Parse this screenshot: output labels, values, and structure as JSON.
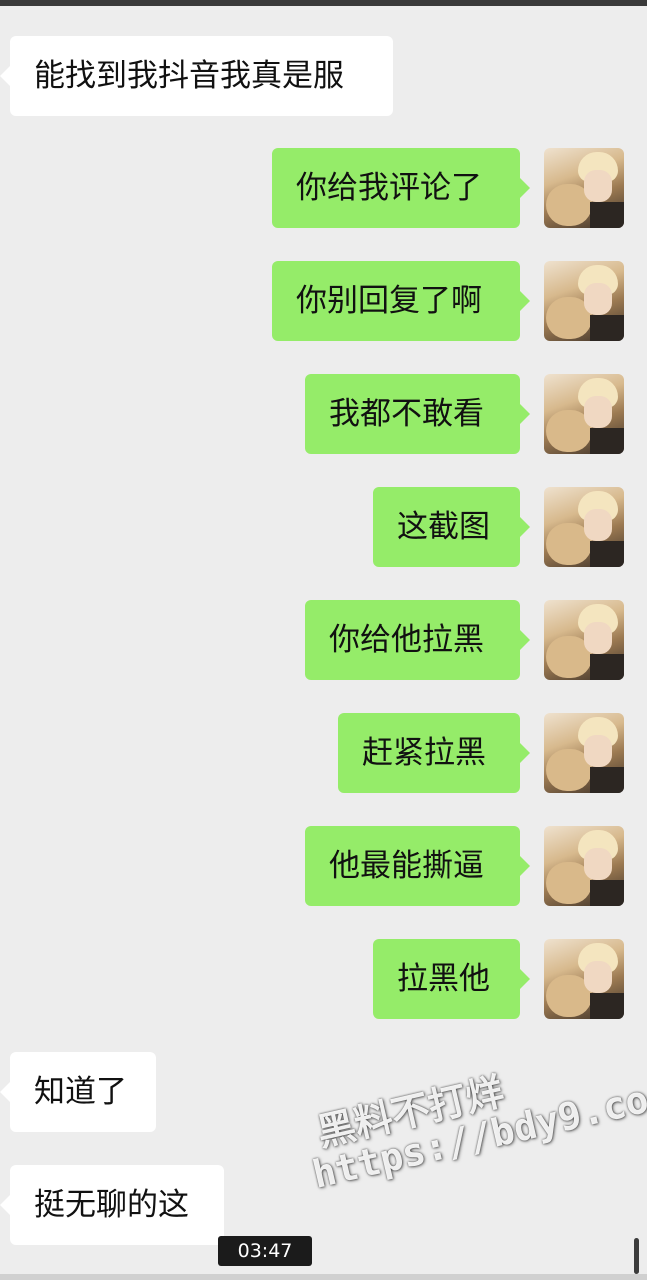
{
  "messages": [
    {
      "side": "received",
      "text": "能找到我抖音我真是服"
    },
    {
      "side": "sent",
      "text": "你给我评论了"
    },
    {
      "side": "sent",
      "text": "你别回复了啊"
    },
    {
      "side": "sent",
      "text": "我都不敢看"
    },
    {
      "side": "sent",
      "text": "这截图"
    },
    {
      "side": "sent",
      "text": "你给他拉黑"
    },
    {
      "side": "sent",
      "text": "赶紧拉黑"
    },
    {
      "side": "sent",
      "text": "他最能撕逼"
    },
    {
      "side": "sent",
      "text": "拉黑他"
    },
    {
      "side": "received",
      "text": "知道了"
    },
    {
      "side": "received",
      "text": "挺无聊的这"
    }
  ],
  "watermark": {
    "line1": "黑料不打烊",
    "line2": "https://bdy9.co"
  },
  "video_time": "03:47",
  "colors": {
    "background": "#ededed",
    "sent_bubble": "#95ec69",
    "received_bubble": "#ffffff"
  }
}
